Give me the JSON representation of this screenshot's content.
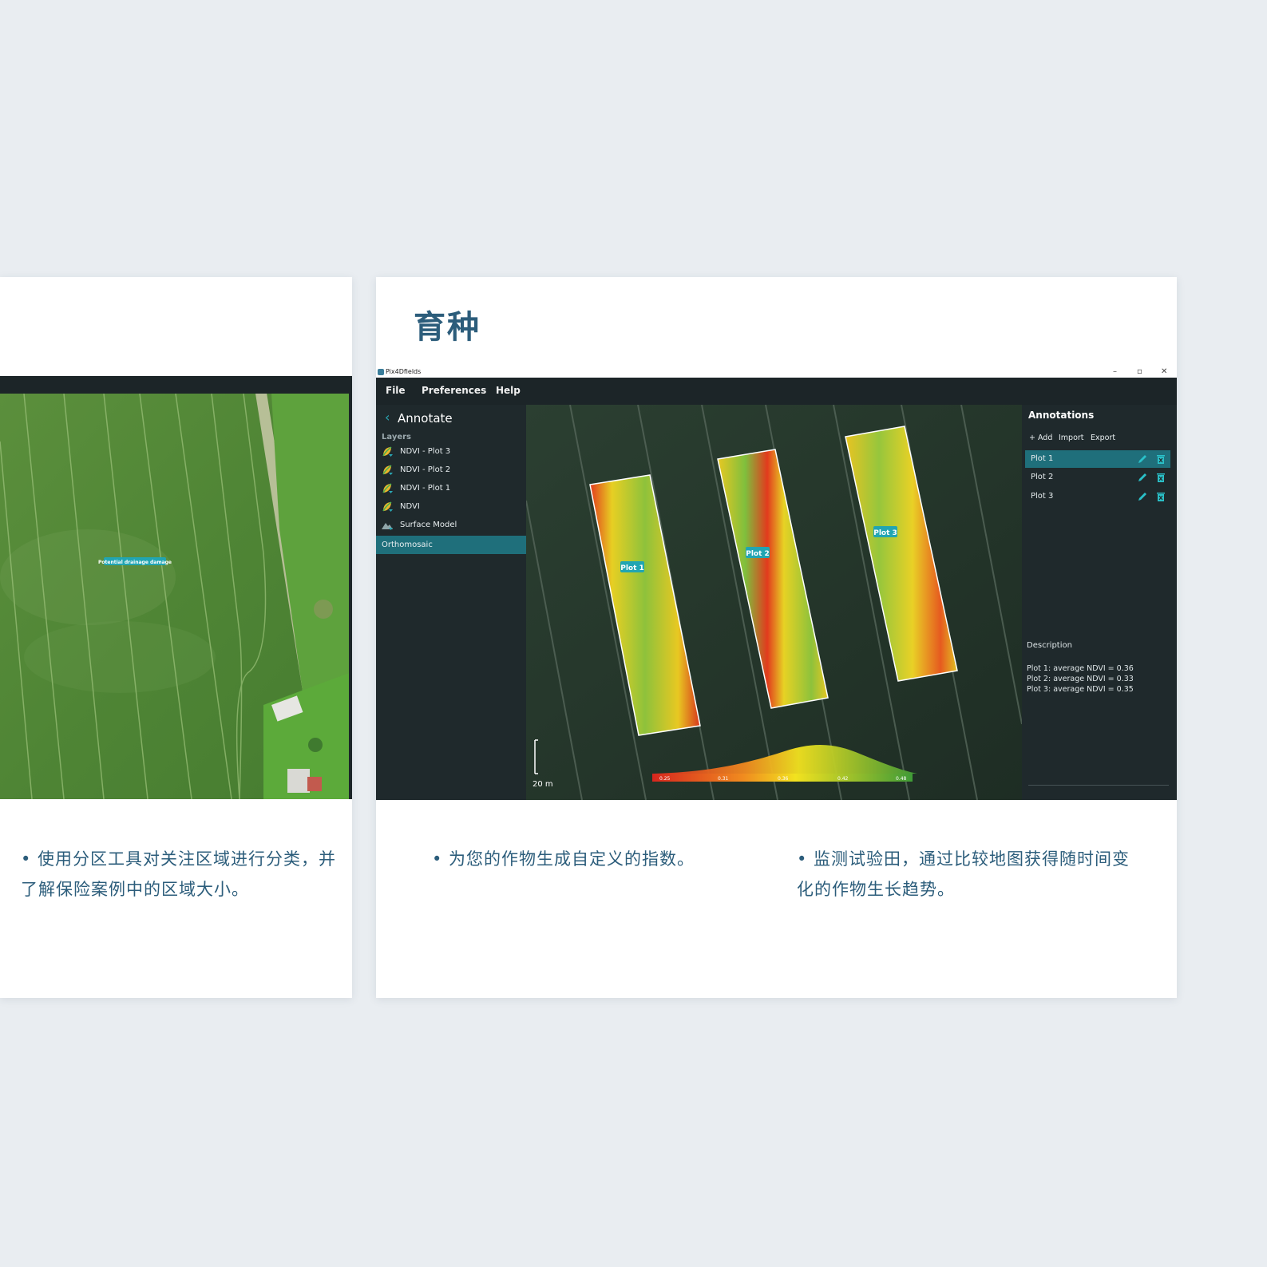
{
  "left_card": {
    "map_label": "Potential drainage damage",
    "caption": "• 使用分区工具对关注区域进行分类，并了解保险案例中的区域大小。"
  },
  "right_card": {
    "title": "育种",
    "caption_left": "• 为您的作物生成自定义的指数。",
    "caption_right": "• 监测试验田，通过比较地图获得随时间变化的作物生长趋势。"
  },
  "app": {
    "window_title": "Pix4Dfields",
    "window_controls": [
      "–",
      "▫",
      "✕"
    ],
    "menu": [
      "File",
      "Preferences",
      "Help"
    ],
    "panel_title": "Annotate",
    "layers_label": "Layers",
    "layers": [
      {
        "label": "NDVI - Plot 3",
        "icon": "ndvi-leaf-icon"
      },
      {
        "label": "NDVI - Plot 2",
        "icon": "ndvi-leaf-icon"
      },
      {
        "label": "NDVI - Plot 1",
        "icon": "ndvi-leaf-icon"
      },
      {
        "label": "NDVI",
        "icon": "ndvi-leaf-icon"
      },
      {
        "label": "Surface Model",
        "icon": "terrain-icon"
      },
      {
        "label": "Orthomosaic",
        "icon": "",
        "active": true
      }
    ],
    "map": {
      "plot_labels": [
        "Plot 1",
        "Plot 2",
        "Plot 3"
      ],
      "scale_label": "20 m",
      "legend_ticks": [
        "0.25",
        "0.31",
        "0.36",
        "0.42",
        "0.48"
      ]
    },
    "annotations": {
      "title": "Annotations",
      "actions": [
        "+ Add",
        "Import",
        "Export"
      ],
      "items": [
        {
          "label": "Plot 1",
          "active": true
        },
        {
          "label": "Plot 2",
          "active": false
        },
        {
          "label": "Plot 3",
          "active": false
        }
      ],
      "description_label": "Description",
      "description_lines": [
        "Plot 1: average NDVI = 0.36",
        "Plot 2: average NDVI = 0.33",
        "Plot 3: average NDVI = 0.35"
      ]
    }
  },
  "colors": {
    "accent": "#1f6f7b",
    "title_blue": "#2c5d7b",
    "label_teal": "#21a5b2"
  }
}
